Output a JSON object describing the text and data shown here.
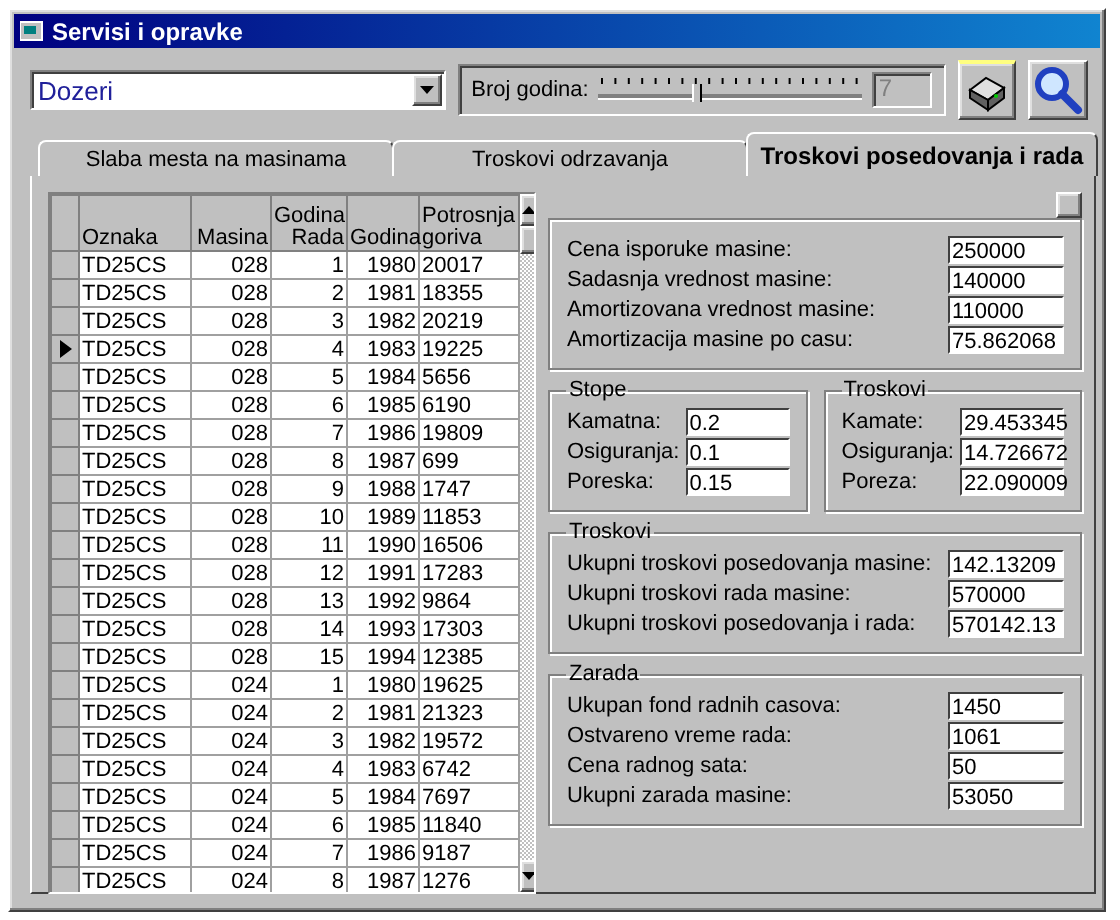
{
  "window": {
    "title": "Servisi i opravke"
  },
  "toolbar": {
    "category": "Dozeri",
    "years_label": "Broj godina:",
    "years_slider": {
      "level": 0.37
    },
    "years_value": "7"
  },
  "tabs": [
    {
      "label": "Slaba mesta na masinama",
      "selected": false
    },
    {
      "label": "Troskovi odrzavanja",
      "selected": false
    },
    {
      "label": "Troskovi posedovanja i rada",
      "selected": true
    }
  ],
  "table": {
    "columns": [
      "Oznaka",
      "Masina",
      "Godina Rada",
      "Godina",
      "Potrosnja goriva"
    ],
    "rows": [
      {
        "cells": [
          "TD25CS",
          "028",
          "1",
          "1980",
          "20017"
        ],
        "selected": false
      },
      {
        "cells": [
          "TD25CS",
          "028",
          "2",
          "1981",
          "18355"
        ],
        "selected": false
      },
      {
        "cells": [
          "TD25CS",
          "028",
          "3",
          "1982",
          "20219"
        ],
        "selected": false
      },
      {
        "cells": [
          "TD25CS",
          "028",
          "4",
          "1983",
          "19225"
        ],
        "selected": true
      },
      {
        "cells": [
          "TD25CS",
          "028",
          "5",
          "1984",
          "5656"
        ],
        "selected": false
      },
      {
        "cells": [
          "TD25CS",
          "028",
          "6",
          "1985",
          "6190"
        ],
        "selected": false
      },
      {
        "cells": [
          "TD25CS",
          "028",
          "7",
          "1986",
          "19809"
        ],
        "selected": false
      },
      {
        "cells": [
          "TD25CS",
          "028",
          "8",
          "1987",
          "699"
        ],
        "selected": false
      },
      {
        "cells": [
          "TD25CS",
          "028",
          "9",
          "1988",
          "1747"
        ],
        "selected": false
      },
      {
        "cells": [
          "TD25CS",
          "028",
          "10",
          "1989",
          "11853"
        ],
        "selected": false
      },
      {
        "cells": [
          "TD25CS",
          "028",
          "11",
          "1990",
          "16506"
        ],
        "selected": false
      },
      {
        "cells": [
          "TD25CS",
          "028",
          "12",
          "1991",
          "17283"
        ],
        "selected": false
      },
      {
        "cells": [
          "TD25CS",
          "028",
          "13",
          "1992",
          "9864"
        ],
        "selected": false
      },
      {
        "cells": [
          "TD25CS",
          "028",
          "14",
          "1993",
          "17303"
        ],
        "selected": false
      },
      {
        "cells": [
          "TD25CS",
          "028",
          "15",
          "1994",
          "12385"
        ],
        "selected": false
      },
      {
        "cells": [
          "TD25CS",
          "024",
          "1",
          "1980",
          "19625"
        ],
        "selected": false
      },
      {
        "cells": [
          "TD25CS",
          "024",
          "2",
          "1981",
          "21323"
        ],
        "selected": false
      },
      {
        "cells": [
          "TD25CS",
          "024",
          "3",
          "1982",
          "19572"
        ],
        "selected": false
      },
      {
        "cells": [
          "TD25CS",
          "024",
          "4",
          "1983",
          "6742"
        ],
        "selected": false
      },
      {
        "cells": [
          "TD25CS",
          "024",
          "5",
          "1984",
          "7697"
        ],
        "selected": false
      },
      {
        "cells": [
          "TD25CS",
          "024",
          "6",
          "1985",
          "11840"
        ],
        "selected": false
      },
      {
        "cells": [
          "TD25CS",
          "024",
          "7",
          "1986",
          "9187"
        ],
        "selected": false
      },
      {
        "cells": [
          "TD25CS",
          "024",
          "8",
          "1987",
          "1276"
        ],
        "selected": false
      }
    ]
  },
  "panel": {
    "purchase": {
      "fields": [
        {
          "label": "Cena isporuke masine:",
          "value": "250000"
        },
        {
          "label": "Sadasnja vrednost masine:",
          "value": "140000"
        },
        {
          "label": "Amortizovana vrednost masine:",
          "value": "110000"
        },
        {
          "label": "Amortizacija masine po casu:",
          "value": "75.862068"
        }
      ]
    },
    "pair": [
      {
        "title": "Stope",
        "fields": [
          {
            "label": "Kamatna:",
            "value": "0.2"
          },
          {
            "label": "Osiguranja:",
            "value": "0.1"
          },
          {
            "label": "Poreska:",
            "value": "0.15"
          }
        ]
      },
      {
        "title": "Troskovi",
        "fields": [
          {
            "label": "Kamate:",
            "value": "29.453345"
          },
          {
            "label": "Osiguranja:",
            "value": "14.726672"
          },
          {
            "label": "Poreza:",
            "value": "22.090009"
          }
        ]
      }
    ],
    "sections": [
      {
        "title": "Troskovi",
        "fields": [
          {
            "label": "Ukupni troskovi posedovanja masine:",
            "value": "142.13209"
          },
          {
            "label": "Ukupni troskovi rada masine:",
            "value": "570000"
          },
          {
            "label": "Ukupni troskovi posedovanja i rada:",
            "value": "570142.13"
          }
        ]
      },
      {
        "title": "Zarada",
        "fields": [
          {
            "label": "Ukupan fond radnih casova:",
            "value": "1450"
          },
          {
            "label": "Ostvareno vreme rada:",
            "value": "1061"
          },
          {
            "label": "Cena radnog sata:",
            "value": "50"
          },
          {
            "label": "Ukupni zarada masine:",
            "value": "53050"
          }
        ]
      }
    ]
  }
}
